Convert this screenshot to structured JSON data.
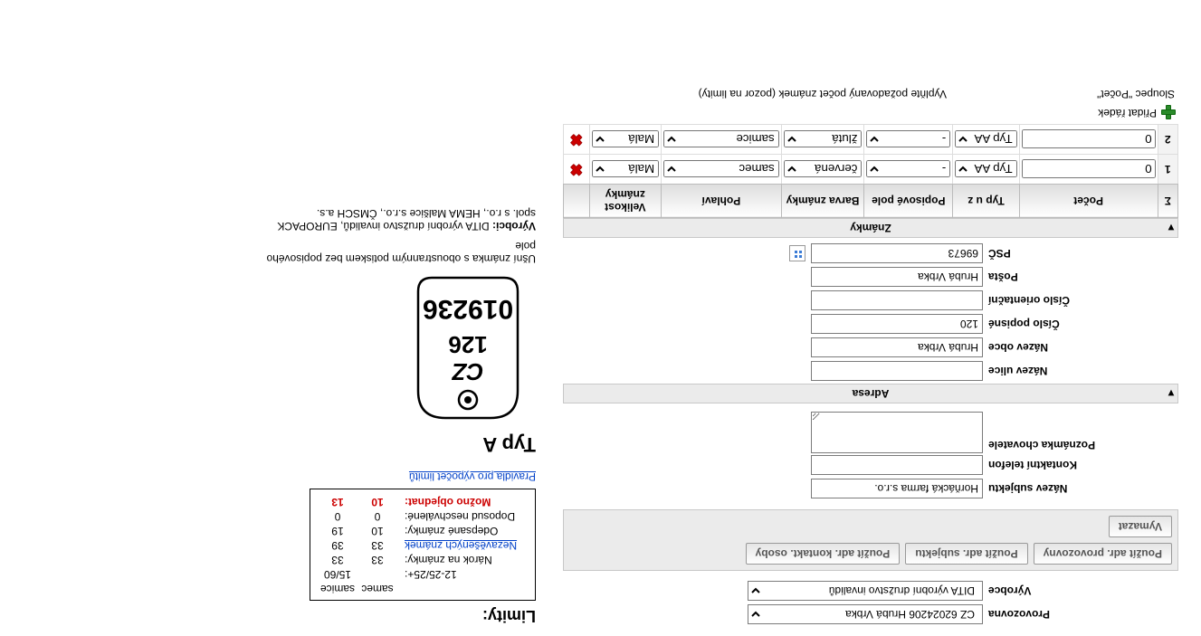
{
  "top": {
    "provozovna_label": "Provozovna",
    "provozovna_value": "CZ 62024206 Hrubá Vrbka",
    "vyrobce_label": "Výrobce",
    "vyrobce_value": "DITA výrobní družstvo invalidů"
  },
  "btns": {
    "provoz": "Použít adr. provozovny",
    "subjekt": "Použít adr. subjektu",
    "osoby": "Použít adr. kontakt. osoby",
    "vymazat": "Vymazat"
  },
  "form": {
    "nazev_subjektu_label": "Název subjektu",
    "nazev_subjektu_value": "Horňácká farma s.r.o.",
    "tel_label": "Kontaktní telefon",
    "tel_value": "",
    "pozn_label": "Poznámka chovatele",
    "pozn_value": ""
  },
  "adresa": {
    "title": "Adresa",
    "ulice_label": "Název ulice",
    "ulice_value": "",
    "obec_label": "Název obce",
    "obec_value": "Hrubá Vrbka",
    "cp_label": "Číslo popisné",
    "cp_value": "120",
    "co_label": "Číslo orientační",
    "co_value": "",
    "posta_label": "Pošta",
    "posta_value": "Hrubá Vrbka",
    "psc_label": "PSČ",
    "psc_value": "69673"
  },
  "znamky": {
    "title": "Známky",
    "cols": [
      "Σ",
      "Počet",
      "Typ u z",
      "Popisové pole",
      "Barva známky",
      "Pohlaví",
      "Velikost známky",
      ""
    ],
    "rows": [
      {
        "n": "1",
        "pocet": "0",
        "typ": "Typ AA",
        "pop": "-",
        "barva": "červená",
        "pohl": "samec",
        "vel": "Malá"
      },
      {
        "n": "2",
        "pocet": "0",
        "typ": "Typ AA",
        "pop": "-",
        "barva": "žlutá",
        "pohl": "samice",
        "vel": "Malá"
      }
    ],
    "add": "Přidat řádek",
    "hint_left": "Sloupec \"Počet\"",
    "hint_right": "Vyplňte požadovaný počet známek (pozor na limity)"
  },
  "limits": {
    "title": "Limity:",
    "hdr_samec": "samec",
    "hdr_samice": "samice",
    "r1_label": "12-25/25+:",
    "r1_b": "15/60",
    "r2_label": "Nárok na známky:",
    "r2_a": "33",
    "r2_b": "33",
    "r3_label": "Nezavěšených známek",
    "r3_a": "33",
    "r3_b": "39",
    "r4_label": "Odepsané známky:",
    "r4_a": "10",
    "r4_b": "19",
    "r5_label": "Doposud neschválené:",
    "r5_a": "0",
    "r5_b": "0",
    "r6_label": "Možno objednat:",
    "r6_a": "10",
    "r6_b": "13",
    "rules": "Pravidla pro výpočet limitů"
  },
  "right": {
    "typ_title": "Typ A",
    "tag_cc": "CZ",
    "tag_mid": "126",
    "tag_big": "019236",
    "desc1": "Ušní známka s oboustranným potiskem bez popisového pole",
    "desc2_label": "Výrobci:",
    "desc2": " DITA výrobní družstvo invalidů, EUROPACK spol. s r.o., HEMA Malšice s.r.o., ČMSCH a.s."
  }
}
